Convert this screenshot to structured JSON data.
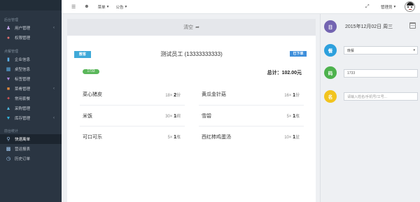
{
  "sidebar": {
    "sections": [
      {
        "title": "后台管理",
        "items": [
          {
            "label": "用户管理",
            "icon": "user-icon",
            "arrow": "‹"
          },
          {
            "label": "权限管理",
            "icon": "shield-icon",
            "arrow": ""
          }
        ]
      },
      {
        "title": "点餐管理",
        "items": [
          {
            "label": "企业信息",
            "icon": "building-icon",
            "arrow": ""
          },
          {
            "label": "桌型信息",
            "icon": "table-icon",
            "arrow": ""
          },
          {
            "label": "标签管理",
            "icon": "tag-icon",
            "arrow": ""
          },
          {
            "label": "菜肴管理",
            "icon": "dish-icon",
            "arrow": "‹"
          },
          {
            "label": "常用套餐",
            "icon": "star-icon",
            "arrow": ""
          },
          {
            "label": "采购管理",
            "icon": "cart-icon",
            "arrow": ""
          },
          {
            "label": "库存管理",
            "icon": "box-icon",
            "arrow": "‹"
          }
        ]
      },
      {
        "title": "前台统计",
        "items": [
          {
            "label": "快速离单",
            "icon": "search-icon",
            "arrow": "",
            "active": true
          },
          {
            "label": "营运报表",
            "icon": "bar-chart-icon",
            "arrow": ""
          },
          {
            "label": "历史订单",
            "icon": "history-icon",
            "arrow": ""
          }
        ]
      }
    ]
  },
  "topbar": {
    "menu1": "菜单",
    "menu2": "公告",
    "admin": "管理员"
  },
  "main": {
    "clear_label": "清空",
    "customer_button": "散客",
    "title": "测试员工 (13333333333)",
    "pending_button": "已下单",
    "table_no": "1733",
    "total": "总计：102.00元",
    "dishes": [
      {
        "name": "菜心猪皮",
        "qty_prefix": "18×",
        "qty": "2",
        "unit": "份"
      },
      {
        "name": "黄瓜金针菇",
        "qty_prefix": "16×",
        "qty": "1",
        "unit": "份"
      },
      {
        "name": "米饭",
        "qty_prefix": "30×",
        "qty": "1",
        "unit": "碗"
      },
      {
        "name": "雪碧",
        "qty_prefix": "5×",
        "qty": "1",
        "unit": "瓶"
      },
      {
        "name": "可口可乐",
        "qty_prefix": "5×",
        "qty": "1",
        "unit": "瓶"
      },
      {
        "name": "西红柿鸡蛋汤",
        "qty_prefix": "10×",
        "qty": "1",
        "unit": "盆"
      }
    ]
  },
  "right": {
    "date_circle": "日",
    "date_text": "2015年12月02日 周三",
    "meal_circle": "餐",
    "meal_value": "晚餐",
    "code_circle": "码",
    "code_value": "1733",
    "name_circle": "名",
    "name_placeholder": "请输入姓名/手机号/工号..."
  },
  "colors": {
    "sidebar_bg": "#2a3542",
    "date_circle": "#7364b1",
    "meal_circle": "#2da0dd",
    "code_circle": "#4db24d",
    "name_circle": "#f2c41e",
    "accent_blue": "#3fa9d8"
  }
}
